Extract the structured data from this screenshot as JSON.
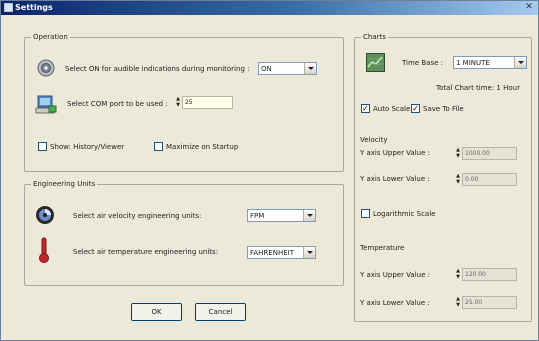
{
  "window": {
    "title": "Settings",
    "icon": "settings-window-icon"
  },
  "operation": {
    "legend": "Operation",
    "audible_label": "Select ON for audible indications during monitoring :",
    "audible_value": "ON",
    "com_label": "Select COM port to be used :",
    "com_value": "25",
    "show_history_label": "Show: History/Viewer",
    "show_history_checked": false,
    "maximize_label": "Maximize on Startup",
    "maximize_checked": false
  },
  "engineering_units": {
    "legend": "Engineering Units",
    "velocity_label": "Select air velocity engineering units:",
    "velocity_value": "FPM",
    "temperature_label": "Select air temperature engineering units:",
    "temperature_value": "FAHRENHEIT"
  },
  "charts": {
    "legend": "Charts",
    "time_base_label": "Time Base :",
    "time_base_value": "1 MINUTE",
    "total_chart_time": "Total Chart time: 1 Hour",
    "auto_scale_label": "Auto Scale",
    "auto_scale_checked": true,
    "save_to_file_label": "Save To File",
    "save_to_file_checked": true,
    "velocity_heading": "Velocity",
    "velocity_upper_label": "Y axis Upper Value :",
    "velocity_upper_value": "1000.00",
    "velocity_lower_label": "Y axis Lower Value :",
    "velocity_lower_value": "0.00",
    "log_scale_label": "Logarithmic Scale",
    "log_scale_checked": false,
    "temperature_heading": "Temperature",
    "temp_upper_label": "Y axis Upper Value :",
    "temp_upper_value": "120.00",
    "temp_lower_label": "Y axis Lower Value :",
    "temp_lower_value": "25.00"
  },
  "buttons": {
    "ok": "OK",
    "cancel": "Cancel"
  }
}
